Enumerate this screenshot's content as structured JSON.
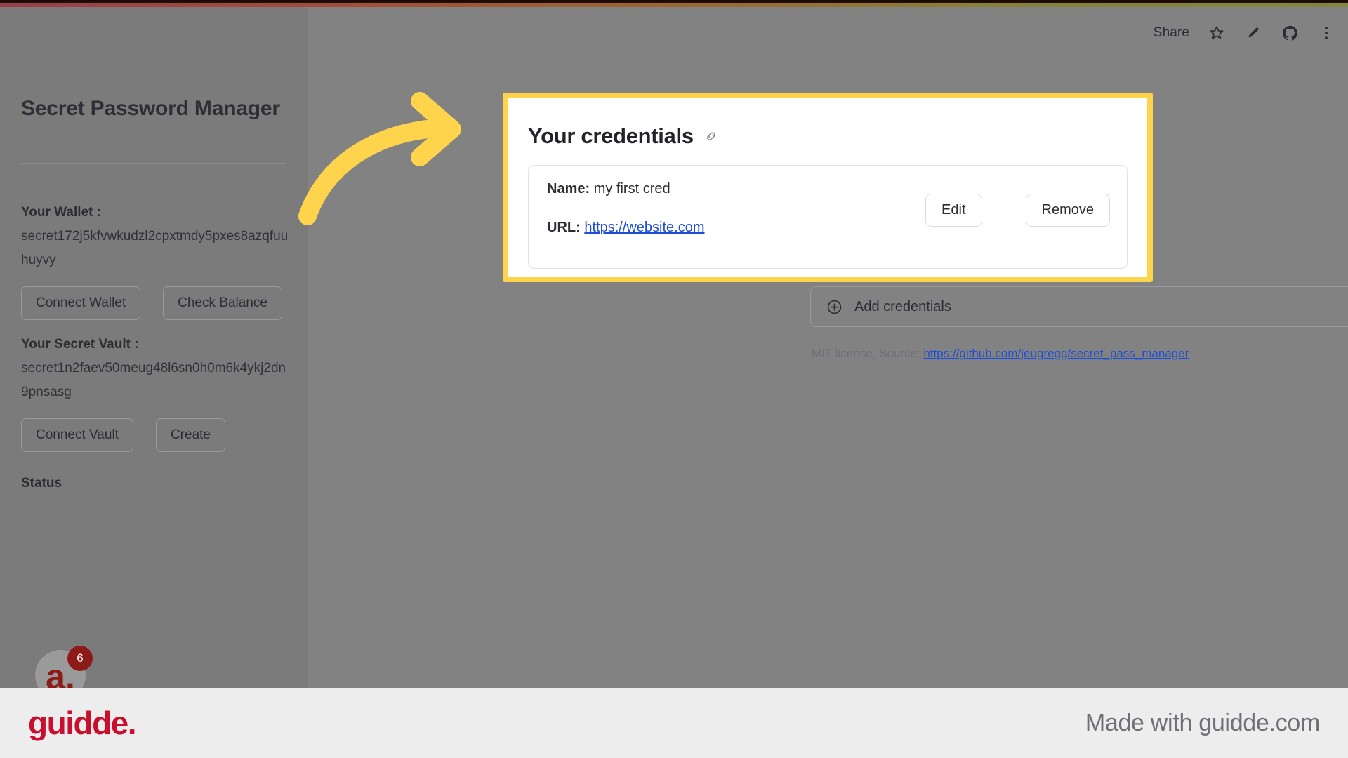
{
  "browser_toolbar": {
    "share_label": "Share",
    "icons": [
      "star-icon",
      "pencil-icon",
      "github-icon",
      "more-vertical-icon"
    ]
  },
  "sidebar": {
    "app_title": "Secret Password Manager",
    "wallet": {
      "label": "Your Wallet :",
      "address": "secret172j5kfvwkudzl2cpxtmdy5pxes8azqfuuhuyvy",
      "buttons": [
        "Connect Wallet",
        "Check Balance"
      ]
    },
    "vault": {
      "label": "Your Secret Vault :",
      "address": "secret1n2faev50meug48l6sn0h0m6k4ykj2dn9pnsasg",
      "buttons": [
        "Connect Vault",
        "Create"
      ]
    },
    "status_label": "Status"
  },
  "credentials_card": {
    "title": "Your credentials",
    "title_icon": "link-icon",
    "items": [
      {
        "name_label": "Name:",
        "name_value": "my first cred",
        "url_label": "URL:",
        "url_value": "https://website.com",
        "edit_label": "Edit",
        "remove_label": "Remove"
      }
    ]
  },
  "add_credentials": {
    "label": "Add credentials",
    "plus_icon": "plus-circle-icon",
    "chevron_icon": "chevron-down-icon"
  },
  "license": {
    "prefix": "MIT license, Source: ",
    "link": "https://github.com/jeugregg/secret_pass_manager"
  },
  "floating_widget": {
    "logo": "a.",
    "badge": "6"
  },
  "footer": {
    "logo": "guidde.",
    "right_text": "Made with guidde.com"
  },
  "colors": {
    "highlight": "#ffd44d",
    "arrow": "#ffd44d",
    "link": "#1d4ed8",
    "brand_red": "#c8102e",
    "widget_red": "#8e1a17"
  }
}
